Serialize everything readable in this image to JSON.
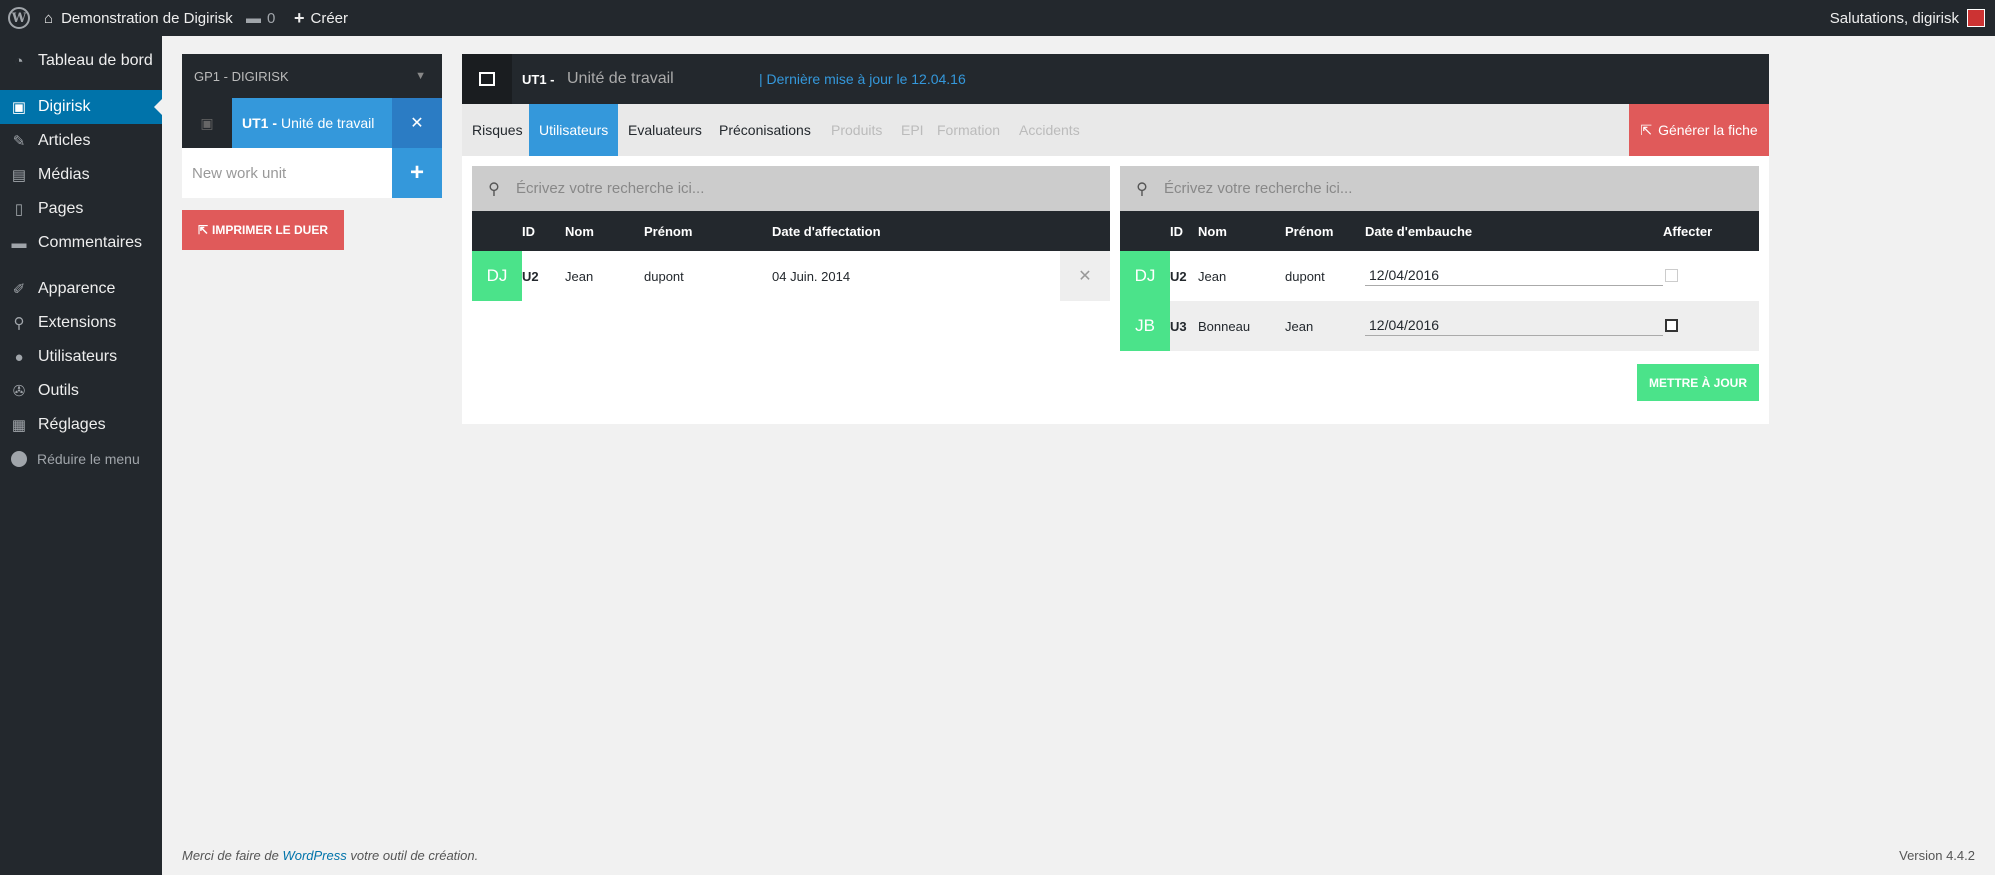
{
  "adminbar": {
    "site_name": "Demonstration de Digirisk",
    "comments_count": "0",
    "new_label": "Créer",
    "greeting": "Salutations, digirisk"
  },
  "menu": {
    "items": [
      {
        "label": "Tableau de bord",
        "icon": "dashboard-icon"
      },
      {
        "label": "Digirisk",
        "icon": "digirisk-icon"
      },
      {
        "label": "Articles",
        "icon": "pin-icon"
      },
      {
        "label": "Médias",
        "icon": "media-icon"
      },
      {
        "label": "Pages",
        "icon": "pages-icon"
      },
      {
        "label": "Commentaires",
        "icon": "comment-icon"
      },
      {
        "label": "Apparence",
        "icon": "brush-icon"
      },
      {
        "label": "Extensions",
        "icon": "plugin-icon"
      },
      {
        "label": "Utilisateurs",
        "icon": "user-icon"
      },
      {
        "label": "Outils",
        "icon": "wrench-icon"
      },
      {
        "label": "Réglages",
        "icon": "settings-icon"
      }
    ],
    "collapse_label": "Réduire le menu"
  },
  "navigation": {
    "group_label": "GP1 - DIGIRISK",
    "unit_ref": "UT1 -",
    "unit_name": "Unité de travail",
    "new_unit_placeholder": "New work unit",
    "print_label": "IMPRIMER LE DUER"
  },
  "header": {
    "ref": "UT1 -",
    "title": "Unité de travail",
    "last_update": "| Dernière mise à jour le 12.04.16"
  },
  "tabs": [
    {
      "label": "Risques",
      "state": "normal"
    },
    {
      "label": "Utilisateurs",
      "state": "active"
    },
    {
      "label": "Evaluateurs",
      "state": "normal"
    },
    {
      "label": "Préconisations",
      "state": "normal"
    },
    {
      "label": "Produits",
      "state": "disabled"
    },
    {
      "label": "EPI",
      "state": "disabled"
    },
    {
      "label": "Formation",
      "state": "disabled"
    },
    {
      "label": "Accidents",
      "state": "disabled"
    }
  ],
  "generate_label": "Générer la fiche",
  "affected_users": {
    "search_placeholder": "Écrivez votre recherche ici...",
    "columns": [
      "ID",
      "Nom",
      "Prénom",
      "Date d'affectation"
    ],
    "rows": [
      {
        "avatar": "DJ",
        "id": "U2",
        "nom": "Jean",
        "prenom": "dupont",
        "date": "04 Juin. 2014"
      }
    ]
  },
  "available_users": {
    "search_placeholder": "Écrivez votre recherche ici...",
    "columns": [
      "ID",
      "Nom",
      "Prénom",
      "Date d'embauche",
      "Affecter"
    ],
    "rows": [
      {
        "avatar": "DJ",
        "id": "U2",
        "nom": "Jean",
        "prenom": "dupont",
        "date": "12/04/2016",
        "checked": false
      },
      {
        "avatar": "JB",
        "id": "U3",
        "nom": "Bonneau",
        "prenom": "Jean",
        "date": "12/04/2016",
        "checked": false
      }
    ],
    "update_label": "METTRE À JOUR"
  },
  "footer": {
    "text_before": "Merci de faire de ",
    "link": "WordPress",
    "text_after": " votre outil de création.",
    "version": "Version 4.4.2"
  },
  "colors": {
    "accent_blue": "#3498db",
    "red": "#e05a5a",
    "green": "#4be38a",
    "dark": "#23282d"
  }
}
